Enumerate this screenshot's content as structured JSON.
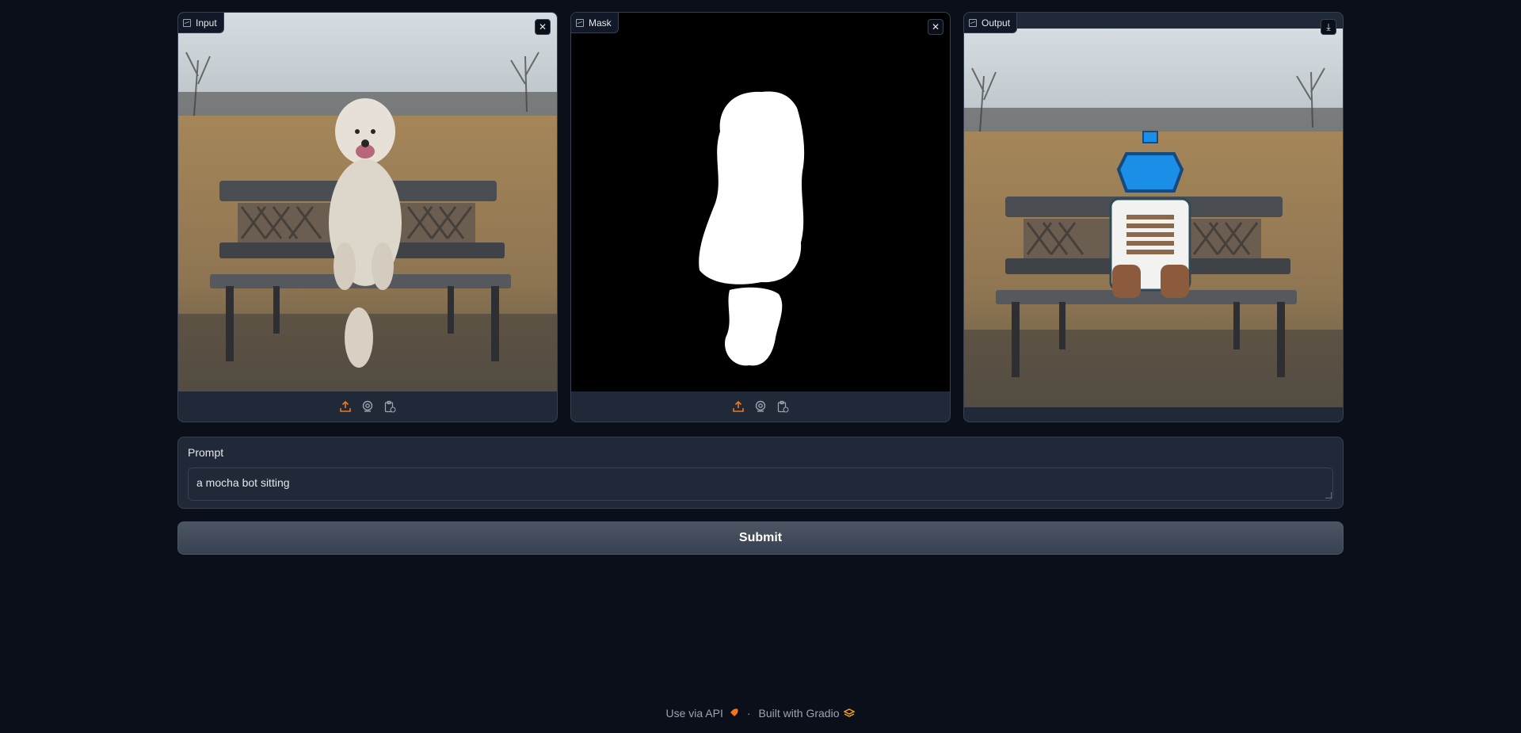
{
  "panels": {
    "input": {
      "label": "Input",
      "close_glyph": "✕"
    },
    "mask": {
      "label": "Mask",
      "close_glyph": "✕"
    },
    "output": {
      "label": "Output",
      "download_glyph": "⤓"
    }
  },
  "toolbar_icons": [
    "upload-icon",
    "webcam-icon",
    "clipboard-icon"
  ],
  "prompt": {
    "label": "Prompt",
    "value": "a mocha bot sitting"
  },
  "submit_label": "Submit",
  "footer": {
    "api_label": "Use via API",
    "separator": "·",
    "built_label": "Built with Gradio"
  },
  "colors": {
    "background": "#0b0f19",
    "panel": "#1f2937",
    "border": "#374151",
    "accent": "#f97316"
  }
}
